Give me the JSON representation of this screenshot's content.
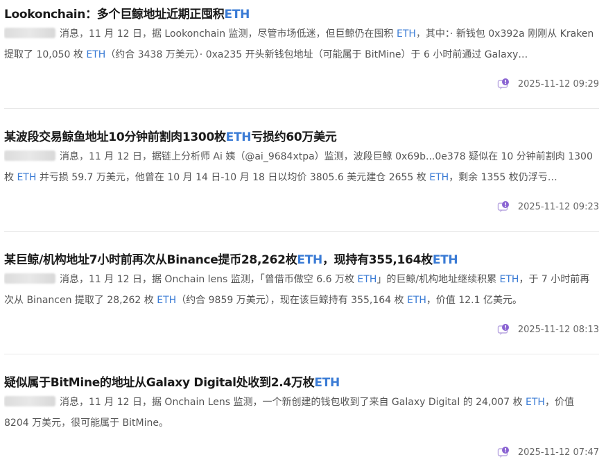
{
  "colors": {
    "accent": "#3a7bd5",
    "icon": "#8a63d2"
  },
  "items": [
    {
      "title": [
        {
          "text": "Lookonchain：多个巨鲸地址近期正囤积",
          "hl": false
        },
        {
          "text": "ETH",
          "hl": true
        }
      ],
      "body": [
        {
          "text": "消息，11 月 12 日，据 Lookonchain 监测，尽管市场低迷，但巨鲸仍在囤积 ",
          "hl": false
        },
        {
          "text": "ETH",
          "hl": true
        },
        {
          "text": "，其中：· 新钱包 0x392a 刚刚从 Kraken 提取了 10,050 枚 ",
          "hl": false
        },
        {
          "text": "ETH",
          "hl": true
        },
        {
          "text": "（约合 3438 万美元）· 0xa235 开头新钱包地址（可能属于 BitMine）于 6 小时前通过 Galaxy…",
          "hl": false
        }
      ],
      "time": "2025-11-12 09:29"
    },
    {
      "title": [
        {
          "text": "某波段交易鲸鱼地址10分钟前割肉1300枚",
          "hl": false
        },
        {
          "text": "ETH",
          "hl": true
        },
        {
          "text": "亏损约60万美元",
          "hl": false
        }
      ],
      "body": [
        {
          "text": "消息，11 月 12 日，据链上分析师 Ai 姨（@ai_9684xtpa）监测，波段巨鲸 0x69b...0e378 疑似在 10 分钟前割肉 1300 枚 ",
          "hl": false
        },
        {
          "text": "ETH",
          "hl": true
        },
        {
          "text": " 并亏损 59.7 万美元，他曾在 10 月 14 日-10 月 18 日以均价 3805.6 美元建仓 2655 枚 ",
          "hl": false
        },
        {
          "text": "ETH",
          "hl": true
        },
        {
          "text": "，剩余 1355 枚仍浮亏…",
          "hl": false
        }
      ],
      "time": "2025-11-12 09:23"
    },
    {
      "title": [
        {
          "text": "某巨鲸/机构地址7小时前再次从Binance提币28,262枚",
          "hl": false
        },
        {
          "text": "ETH",
          "hl": true
        },
        {
          "text": "，现持有355,164枚",
          "hl": false
        },
        {
          "text": "ETH",
          "hl": true
        }
      ],
      "body": [
        {
          "text": "消息，11 月 12 日，据 Onchain lens 监测，「曾借币做空 6.6 万枚 ",
          "hl": false
        },
        {
          "text": "ETH",
          "hl": true
        },
        {
          "text": "」的巨鲸/机构地址继续积累 ",
          "hl": false
        },
        {
          "text": "ETH",
          "hl": true
        },
        {
          "text": "，于 7 小时前再次从 Binancen 提取了 28,262 枚 ",
          "hl": false
        },
        {
          "text": "ETH",
          "hl": true
        },
        {
          "text": "（约合 9859 万美元），现在该巨鲸持有 355,164 枚 ",
          "hl": false
        },
        {
          "text": "ETH",
          "hl": true
        },
        {
          "text": "，价值 12.1 亿美元。",
          "hl": false
        }
      ],
      "time": "2025-11-12 08:13"
    },
    {
      "title": [
        {
          "text": "疑似属于BitMine的地址从Galaxy Digital处收到2.4万枚",
          "hl": false
        },
        {
          "text": "ETH",
          "hl": true
        }
      ],
      "body": [
        {
          "text": "消息，11 月 12 日，据 Onchain Lens 监测，一个新创建的钱包收到了来自 Galaxy Digital 的 24,007 枚 ",
          "hl": false
        },
        {
          "text": "ETH",
          "hl": true
        },
        {
          "text": "，价值 8204 万美元，很可能属于 BitMine。",
          "hl": false
        }
      ],
      "time": "2025-11-12 07:47"
    }
  ]
}
